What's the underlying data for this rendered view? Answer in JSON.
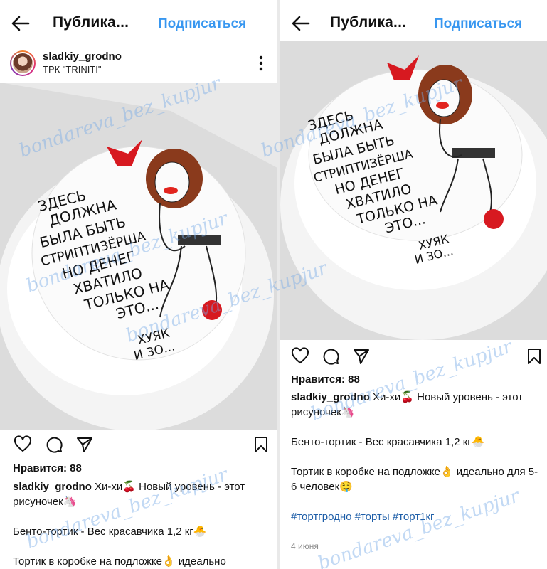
{
  "left": {
    "header": {
      "title": "Публика...",
      "subscribe": "Подписаться"
    },
    "author": {
      "username": "sladkiy_grodno",
      "location": "ТРК \"TRINITI\""
    },
    "likes": "Нравится: 88",
    "caption": {
      "username": "sladkiy_grodno",
      "line1": "Хи-хи🍒 Новый уровень - этот рисуночек🦄",
      "line2": "Бенто-тортик - Вес красавчика 1,2 кг🐣",
      "line3": "Тортик в коробке на подложке👌 идеально"
    }
  },
  "right": {
    "header": {
      "title": "Публика...",
      "subscribe": "Подписаться"
    },
    "likes": "Нравится: 88",
    "caption": {
      "username": "sladkiy_grodno",
      "line1": "Хи-хи🍒 Новый уровень - этот рисуночек🦄",
      "line2": "Бенто-тортик - Вес красавчика 1,2 кг🐣",
      "line3": "Тортик в коробке на подложке👌 идеально для 5-6 человек🤤",
      "hashtags": "#тортгродно #торты #торт1кг",
      "date": "4 июня"
    }
  },
  "cake_text": [
    "ЗДЕСЬ",
    "ДОЛЖНА",
    "БЫЛА БЫТЬ",
    "СТРИПТИЗЁРША",
    "НО ДЕНЕГ",
    "ХВАТИЛО",
    "ТОЛЬКО НА",
    "ЭТО...",
    "ХУЯК",
    "И ЗО..."
  ],
  "watermark": "bondareva_bez_kupjur",
  "colors": {
    "accent": "#3897f0",
    "hashtag": "#1e5ea8"
  },
  "icons": [
    "back-arrow-icon",
    "more-icon",
    "heart-icon",
    "comment-icon",
    "share-icon",
    "bookmark-icon"
  ]
}
